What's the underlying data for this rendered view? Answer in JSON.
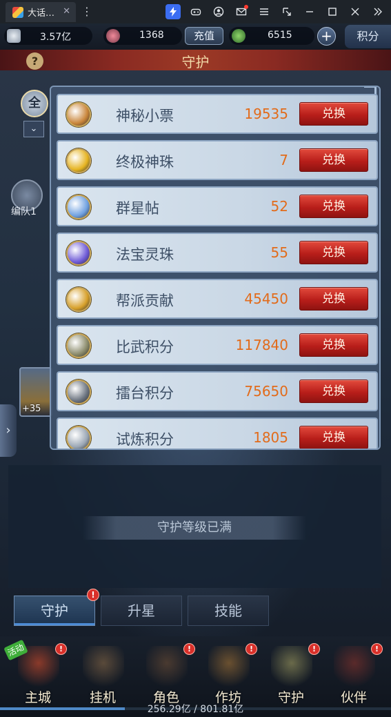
{
  "window": {
    "tab_title": "大话…",
    "menu_glyph": "⋮",
    "close_glyph": "✕",
    "toolbar_icons": [
      "bolt-icon",
      "gamepad-icon",
      "account-icon",
      "mail-icon",
      "menu-icon",
      "resize-icon",
      "minimize-icon",
      "maximize-icon",
      "close-icon",
      "expand-icon"
    ]
  },
  "resources": {
    "silver": "3.57亿",
    "jade": "1368",
    "recharge_label": "充值",
    "gold": "6515",
    "plus": "+",
    "jifen_tab": "积分"
  },
  "header": {
    "title": "守护",
    "help": "?"
  },
  "filter": {
    "all": "全",
    "dropdown": "⌄"
  },
  "team": {
    "label": "编队1"
  },
  "card": {
    "level": "+35"
  },
  "side_arrow": "›",
  "popup": {
    "button_label": "兑换",
    "items": [
      {
        "name": "神秘小票",
        "count": "19535",
        "icon_color": "#c9853a",
        "icon": "ticket-icon"
      },
      {
        "name": "终极神珠",
        "count": "7",
        "icon_color": "#e6b421",
        "icon": "pearl-icon"
      },
      {
        "name": "群星帖",
        "count": "52",
        "icon_color": "#6fa0e0",
        "icon": "star-card-icon"
      },
      {
        "name": "法宝灵珠",
        "count": "55",
        "icon_color": "#6e5ad6",
        "icon": "spirit-orb-icon"
      },
      {
        "name": "帮派贡献",
        "count": "45450",
        "icon_color": "#d7a02a",
        "icon": "guild-coin-icon"
      },
      {
        "name": "比武积分",
        "count": "117840",
        "icon_color": "#8a8a6a",
        "icon": "arena-medal-icon"
      },
      {
        "name": "擂台积分",
        "count": "75650",
        "icon_color": "#6c7480",
        "icon": "ring-medal-icon"
      },
      {
        "name": "试炼积分",
        "count": "1805",
        "icon_color": "#9aa6b4",
        "icon": "trial-medal-icon"
      }
    ]
  },
  "panel": {
    "maxed_text": "守护等级已满"
  },
  "func_tabs": [
    {
      "label": "守护",
      "active": true
    },
    {
      "label": "升星",
      "active": false
    },
    {
      "label": "技能",
      "active": false
    }
  ],
  "func_badge": "!",
  "nav": {
    "event_tag": "活动",
    "items": [
      {
        "label": "主城",
        "badge": "!",
        "color": "#8a3a2a"
      },
      {
        "label": "挂机",
        "badge": "",
        "color": "#5a4a3a"
      },
      {
        "label": "角色",
        "badge": "!",
        "color": "#4a3a30"
      },
      {
        "label": "作坊",
        "badge": "!",
        "color": "#6a5030"
      },
      {
        "label": "守护",
        "badge": "!",
        "color": "#6a6a4a"
      },
      {
        "label": "伙伴",
        "badge": "!",
        "color": "#5a2a2a"
      }
    ],
    "exp_text": "256.29亿 / 801.81亿",
    "exp_fraction": 0.32
  },
  "colors": {
    "count_orange": "#e26b1a",
    "button_red": "#c1201b",
    "badge_red": "#d9302a"
  }
}
